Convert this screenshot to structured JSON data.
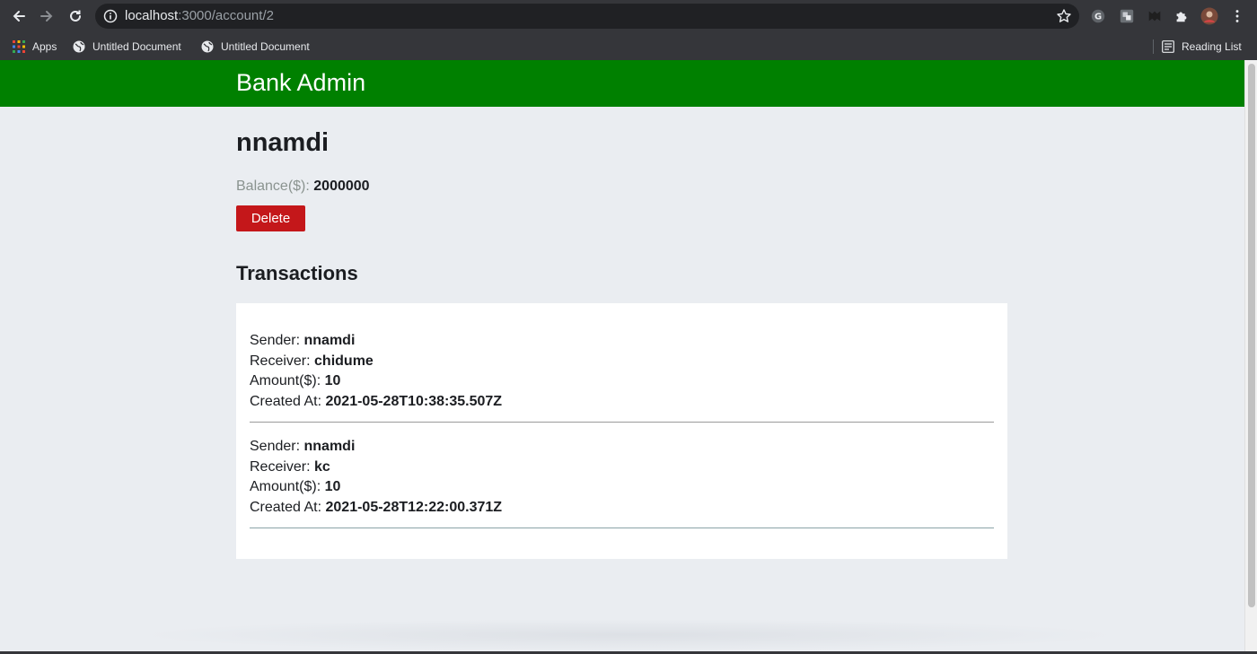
{
  "browser": {
    "url_host": "localhost",
    "url_path": ":3000/account/2",
    "bookmarks": [
      {
        "label": "Apps",
        "icon": "apps-grid-icon"
      },
      {
        "label": "Untitled Document",
        "icon": "globe-icon"
      },
      {
        "label": "Untitled Document",
        "icon": "globe-icon"
      }
    ],
    "reading_list_label": "Reading List",
    "colors": {
      "chrome": "#35363a",
      "omnibox": "#202124"
    }
  },
  "app": {
    "title": "Bank Admin",
    "header_color": "#008000"
  },
  "account": {
    "name": "nnamdi",
    "balance_label": "Balance($):",
    "balance_value": "2000000",
    "delete_label": "Delete",
    "delete_color": "#c4171a"
  },
  "transactions": {
    "title": "Transactions",
    "labels": {
      "sender": "Sender:",
      "receiver": "Receiver:",
      "amount": "Amount($):",
      "created_at": "Created At:"
    },
    "items": [
      {
        "sender": "nnamdi",
        "receiver": "chidume",
        "amount": "10",
        "created_at": "2021-05-28T10:38:35.507Z"
      },
      {
        "sender": "nnamdi",
        "receiver": "kc",
        "amount": "10",
        "created_at": "2021-05-28T12:22:00.371Z"
      }
    ]
  }
}
